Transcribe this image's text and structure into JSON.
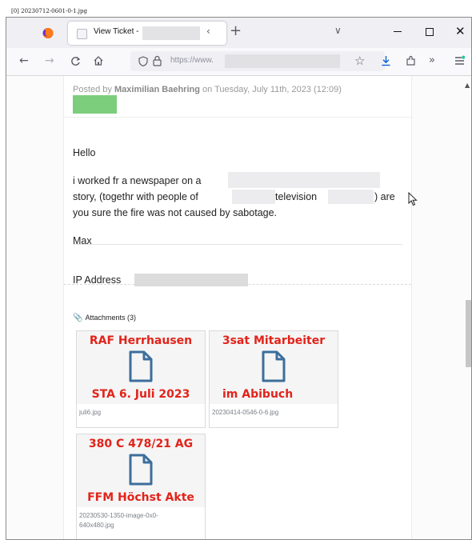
{
  "image_label": "[0] 20230712-0601-0-1.jpg",
  "browser": {
    "tab_title": "View Ticket -",
    "tab_close": "‹",
    "new_tab": "+",
    "tab_list": "∨",
    "window_close": "✕",
    "url_text": "https://www."
  },
  "icons": [
    "firefox-icon",
    "back-icon",
    "forward-icon",
    "reload-icon",
    "home-icon",
    "shield-icon",
    "lock-icon",
    "star-icon",
    "download-icon",
    "extensions-icon",
    "overflow-icon",
    "menu-icon"
  ],
  "post": {
    "posted_prefix": "Posted by",
    "author": "Maximilian Baehring",
    "posted_on": "on Tuesday, July 11th, 2023 (12:09)",
    "greeting": "Hello",
    "line1": "i worked fr a newspaper on a",
    "line2_a": "story, (togethr with people of",
    "line2_b": "television",
    "line2_c": ") are",
    "line3": "you sure the fire was not caused by sabotage.",
    "signature": "Max",
    "ip_label": "IP Address"
  },
  "attachments": {
    "title": "Attachments (3)",
    "items": [
      {
        "top_text": "RAF Herrhausen",
        "bottom_text": "STA 6. Juli 2023",
        "filename": "juli6.jpg"
      },
      {
        "top_text": "3sat Mitarbeiter",
        "bottom_text": "im Abibuch",
        "filename": "20230414-0546-0-6.jpg"
      },
      {
        "top_text": "380 C 478/21 AG",
        "bottom_text": "FFM Höchst Akte",
        "filename": "20230530-1350-image-0x0-640x480.jpg"
      }
    ]
  },
  "colors": {
    "accent_red": "#e2231a",
    "doc_icon_blue": "#3c6e9c",
    "badge_green": "#7ccd7c"
  }
}
